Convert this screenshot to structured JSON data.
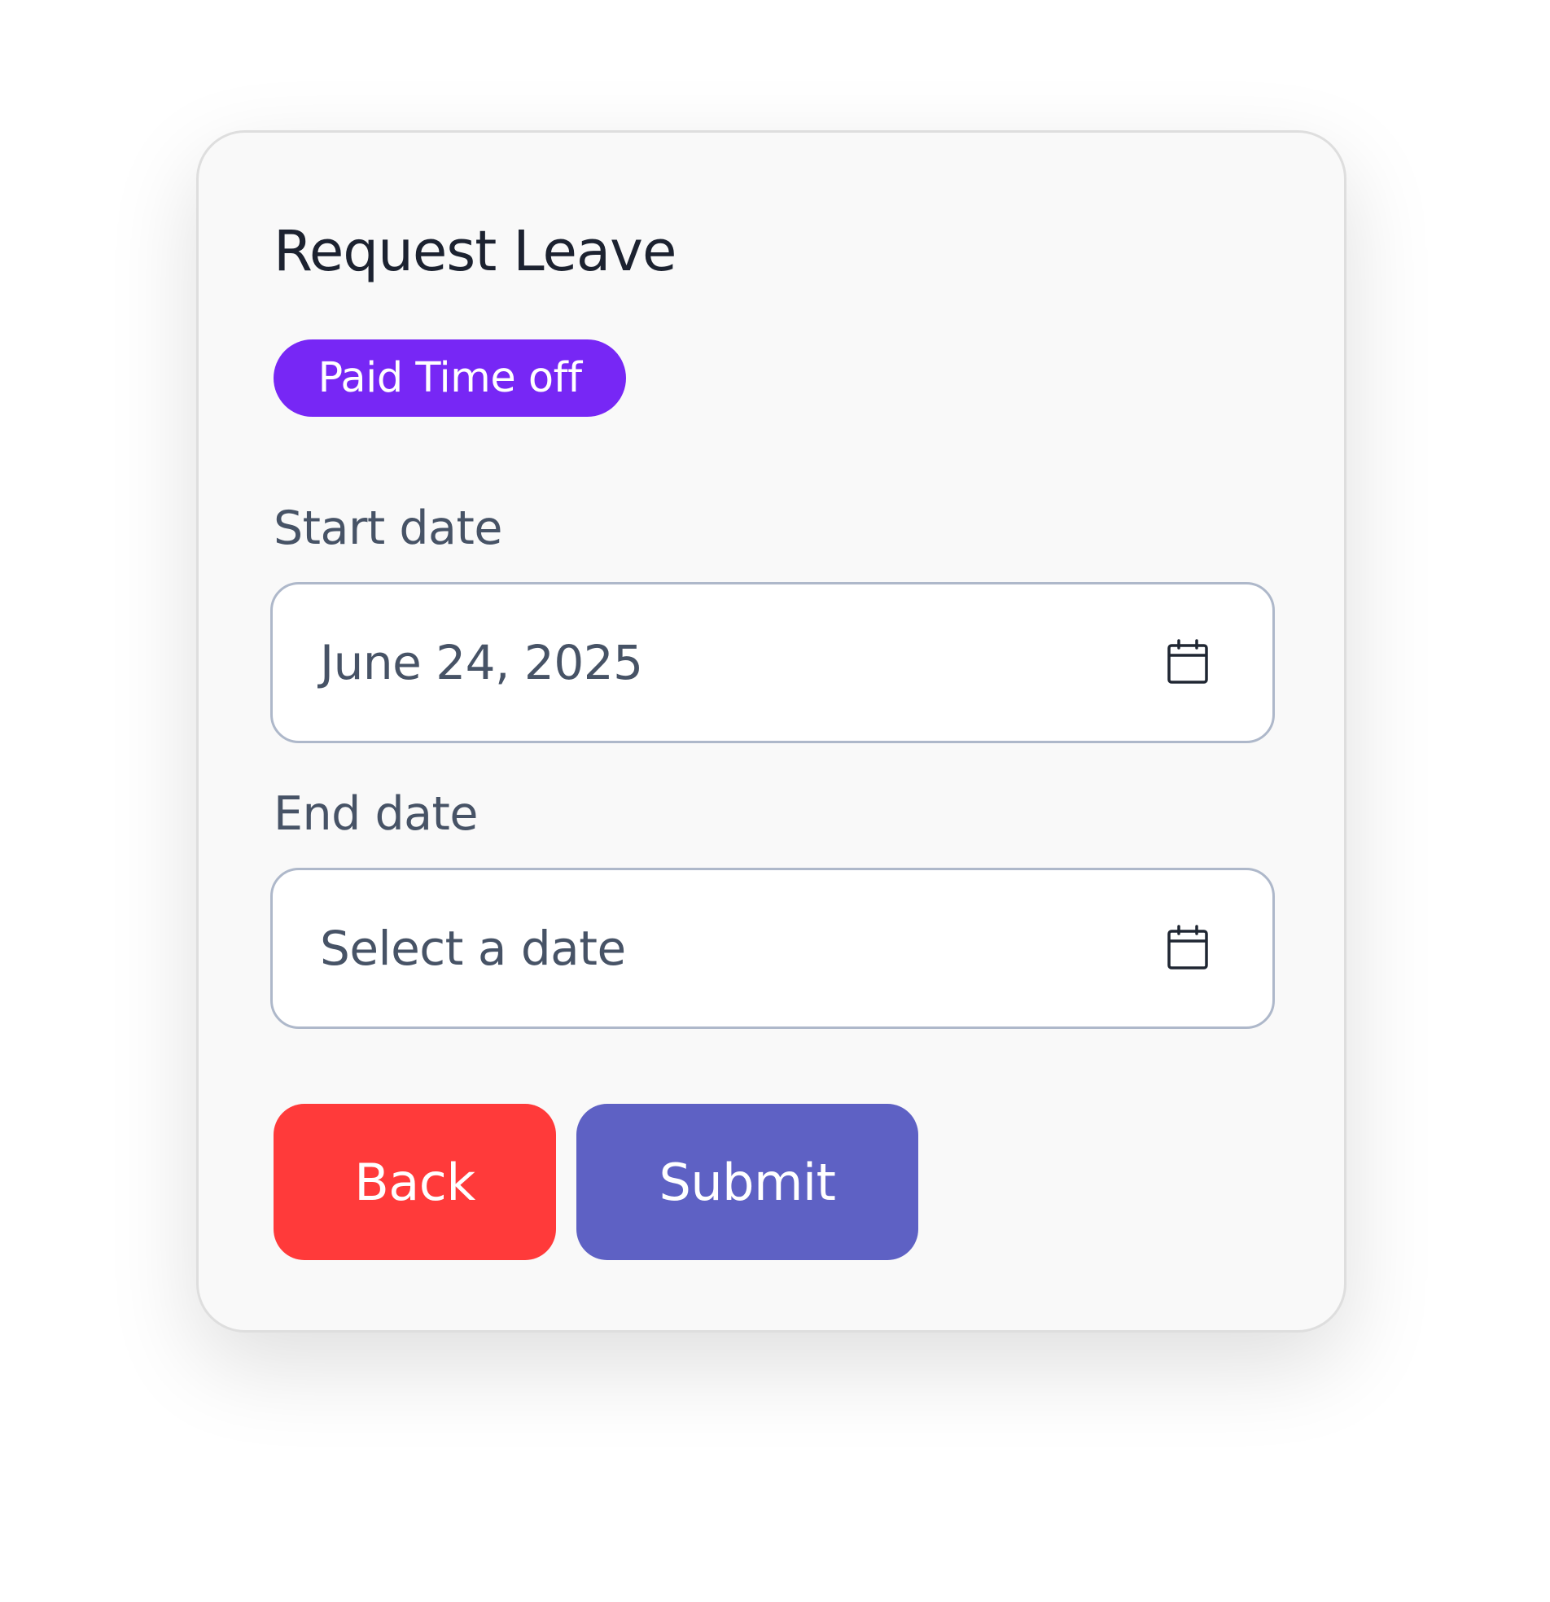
{
  "form": {
    "title": "Request Leave",
    "leave_type_badge": "Paid Time off",
    "start_date": {
      "label": "Start date",
      "value": "June 24, 2025"
    },
    "end_date": {
      "label": "End date",
      "placeholder": "Select a date"
    },
    "buttons": {
      "back_label": "Back",
      "submit_label": "Submit"
    }
  },
  "colors": {
    "badge": "#7727f5",
    "back_button": "#ff3a3a",
    "submit_button": "#5e61c4",
    "field_border": "#aeb8ca",
    "card_background": "#f9f9f9"
  },
  "icons": {
    "date_field": "calendar-icon"
  }
}
